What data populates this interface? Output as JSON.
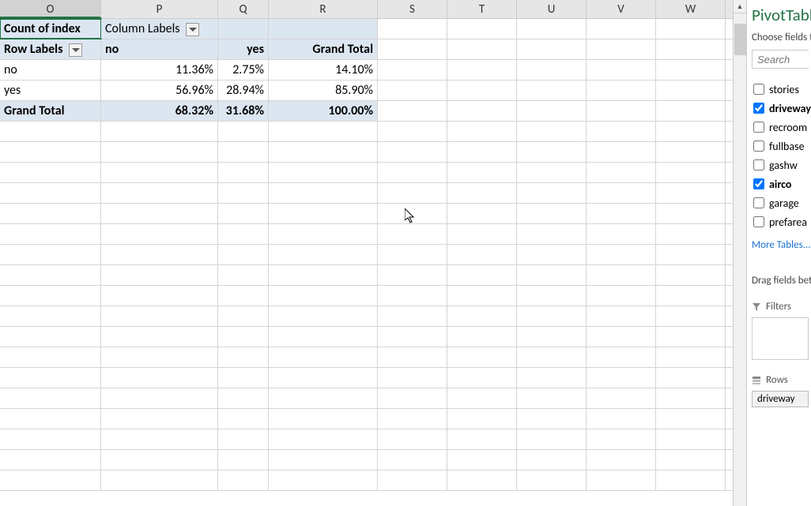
{
  "columns": [
    "O",
    "P",
    "Q",
    "R",
    "S",
    "T",
    "U",
    "V",
    "W"
  ],
  "pivot": {
    "count_label": "Count of index",
    "colLabelsHdr": "Column Labels",
    "rowLabelsHdr": "Row Labels",
    "colHeaders": {
      "no": "no",
      "yes": "yes",
      "grand": "Grand Total"
    },
    "rows": [
      {
        "label": "no",
        "no": "11.36%",
        "yes": "2.75%",
        "total": "14.10%"
      },
      {
        "label": "yes",
        "no": "56.96%",
        "yes": "28.94%",
        "total": "85.90%"
      }
    ],
    "grandRow": {
      "label": "Grand Total",
      "no": "68.32%",
      "yes": "31.68%",
      "total": "100.00%"
    }
  },
  "panel": {
    "title": "PivotTable Fields",
    "choose": "Choose fields to add to report:",
    "searchPlaceholder": "Search",
    "fields": [
      {
        "name": "stories",
        "checked": false
      },
      {
        "name": "driveway",
        "checked": true
      },
      {
        "name": "recroom",
        "checked": false
      },
      {
        "name": "fullbase",
        "checked": false
      },
      {
        "name": "gashw",
        "checked": false
      },
      {
        "name": "airco",
        "checked": true
      },
      {
        "name": "garage",
        "checked": false
      },
      {
        "name": "prefarea",
        "checked": false
      }
    ],
    "moreTables": "More Tables...",
    "dragHint": "Drag fields between areas below:",
    "filtersLabel": "Filters",
    "areaRowsLabel": "Rows",
    "rowsChip": "driveway"
  }
}
